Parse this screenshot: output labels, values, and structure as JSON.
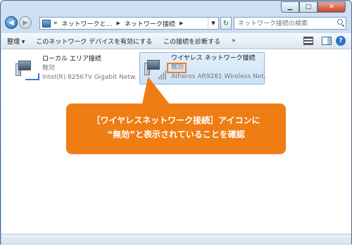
{
  "address": {
    "segments": [
      "«",
      "ネットワークと…",
      "ネットワーク接続"
    ]
  },
  "search": {
    "placeholder": "ネットワーク接続の検索"
  },
  "toolbar": {
    "organize": "整理 ▾",
    "enable_device": "このネットワーク デバイスを有効にする",
    "diagnose": "この接続を診断する",
    "more": "»"
  },
  "connections": [
    {
      "name": "ローカル エリア接続",
      "status": "無効",
      "device": "Intel(R) 82567V Gigabit Netw..."
    },
    {
      "name": "ワイヤレス ネットワーク接続",
      "status": "無効",
      "device": "Atheros AR9281 Wireless Net..."
    }
  ],
  "callout": {
    "line1": "［ワイヤレスネットワーク接続］アイコンに",
    "line2": "“無効”と表示されていることを確認"
  },
  "colors": {
    "accent": "#ee7d14",
    "selection": "#cce2f6"
  }
}
